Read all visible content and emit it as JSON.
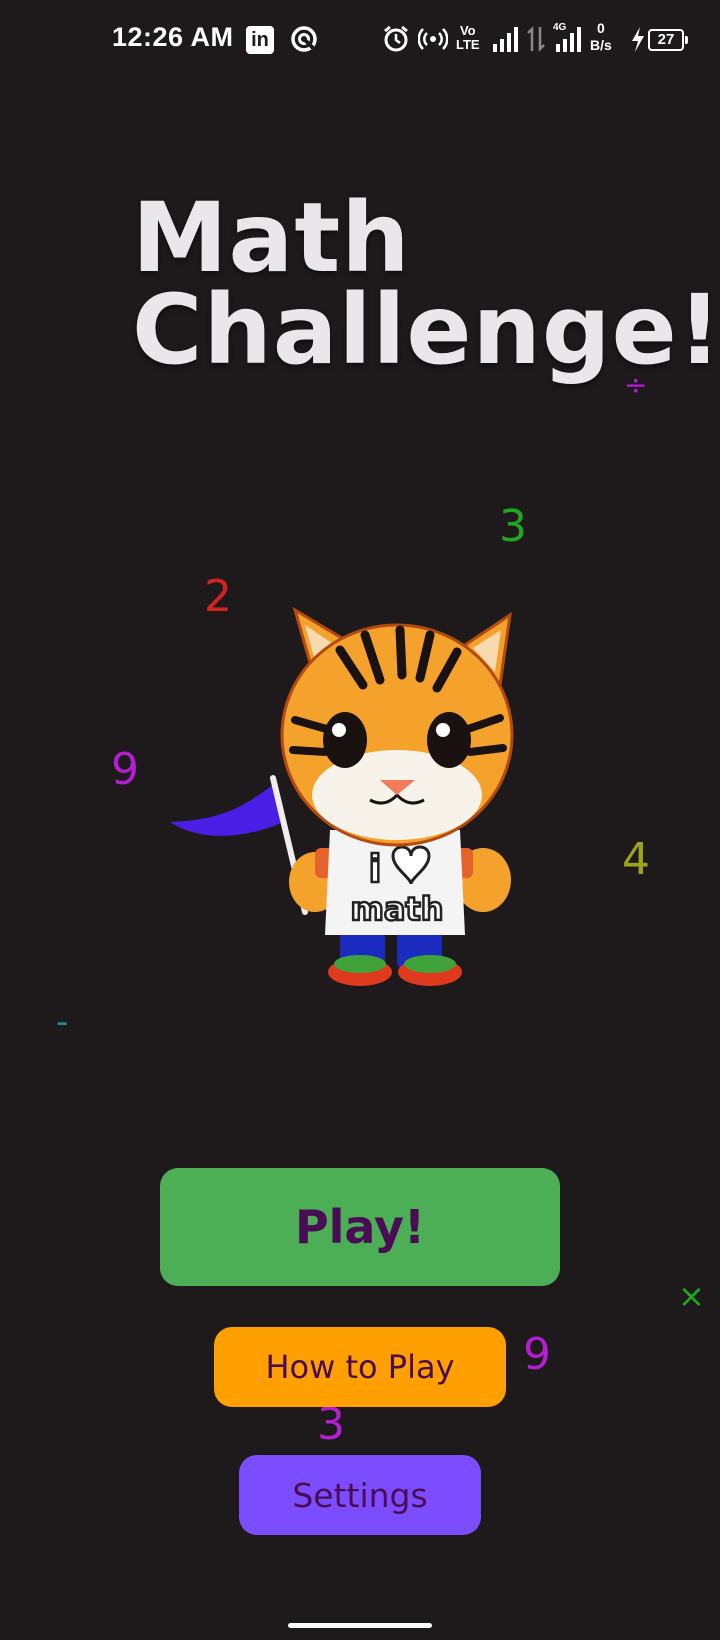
{
  "status_bar": {
    "time": "12:26 AM",
    "linkedin_glyph": "in",
    "volte_text": "Vo\nLTE",
    "net_type": "4G",
    "network_speed": "0\nB/s",
    "battery": "27",
    "icons": [
      "linkedin-icon",
      "sync-icon",
      "alarm-icon",
      "hotspot-icon",
      "volte-icon",
      "signal-icon",
      "transfer-icon",
      "signal-icon",
      "charging-icon",
      "battery-icon"
    ]
  },
  "title": {
    "line1": "Math",
    "line2": "Challenge!"
  },
  "floating_symbols": [
    {
      "text": "÷",
      "color": "#b21fd1"
    },
    {
      "text": "3",
      "color": "#1fa81f"
    },
    {
      "text": "2",
      "color": "#d42222"
    },
    {
      "text": "9",
      "color": "#b21fd1"
    },
    {
      "text": "4",
      "color": "#9da51a"
    },
    {
      "text": "-",
      "color": "#1a8f9a"
    },
    {
      "text": "×",
      "color": "#1fa81f"
    },
    {
      "text": "9",
      "color": "#b21fd1"
    },
    {
      "text": "3",
      "color": "#b21fd1"
    }
  ],
  "mascot": {
    "shirt_line1": "i",
    "shirt_line2": "math"
  },
  "buttons": {
    "play": "Play!",
    "how_to_play": "How to Play",
    "settings": "Settings"
  },
  "colors": {
    "background": "#1e1a1c",
    "play_button": "#4caf55",
    "how_to_play_button": "#ff9f00",
    "settings_button": "#7c4dff",
    "button_text": "#4a0d55",
    "title_text": "#e9e7ea"
  }
}
